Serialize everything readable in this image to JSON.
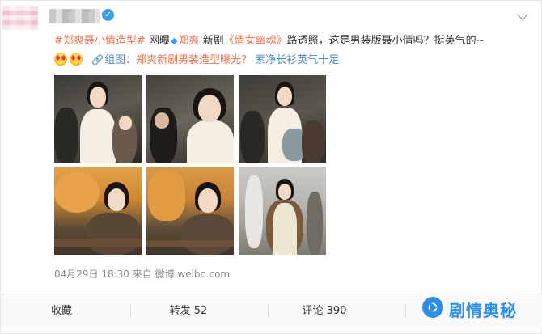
{
  "post": {
    "verify_badge": "✓",
    "line1": {
      "hashtag": "#郑爽聂小倩造型#",
      "word1": "网曝",
      "diamond_icon": "diamond-icon",
      "mention": "郑爽",
      "word2": "新剧",
      "show": "《倩女幽魂》",
      "rest": "路透照，这是男装版聂小倩吗？挺英气的~"
    },
    "line2": {
      "emoji1": "heart-eyes-emoji",
      "emoji2": "heart-eyes-emoji",
      "link_icon": "🔗",
      "link_label": "组图：",
      "link_text": "郑爽新剧男装造型曝光？",
      "link_sub": "素净长衫英气十足"
    }
  },
  "photos": [
    {
      "name": "photo-1"
    },
    {
      "name": "photo-2"
    },
    {
      "name": "photo-3"
    },
    {
      "name": "photo-4"
    },
    {
      "name": "photo-5"
    },
    {
      "name": "photo-6"
    }
  ],
  "meta": {
    "timestamp": "04月29日 18:30 来自 微博 weibo.com"
  },
  "actions": {
    "favorite": "收藏",
    "repost": "转发 52",
    "comment": "评论 390"
  },
  "watermark": {
    "text": "剧情奥秘"
  },
  "colors": {
    "link": "#eb7350",
    "blue_link": "#4a8bc2",
    "watermark": "#2f8fe6"
  }
}
